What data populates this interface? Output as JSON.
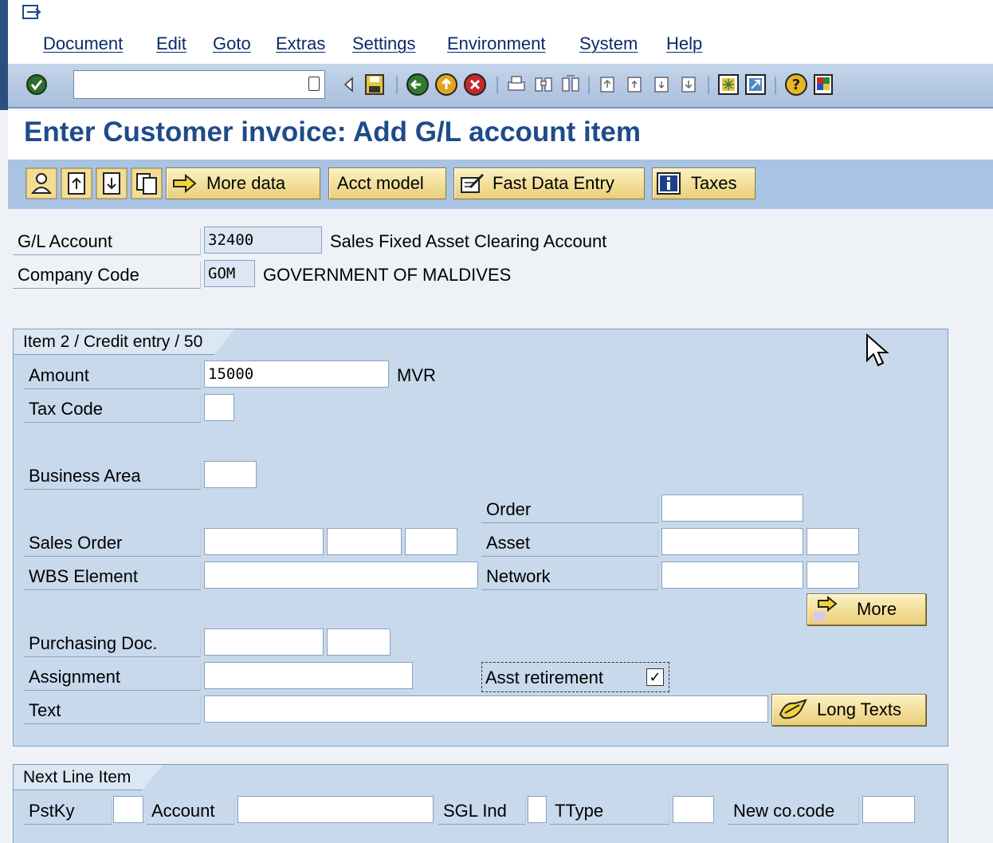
{
  "menubar": {
    "items": [
      "Document",
      "Edit",
      "Goto",
      "Extras",
      "Settings",
      "Environment",
      "System",
      "Help"
    ]
  },
  "toolbar": {
    "command_field_value": ""
  },
  "page": {
    "title": "Enter Customer invoice: Add G/L account item"
  },
  "app_toolbar": {
    "buttons": [
      "More data",
      "Acct model",
      "Fast Data Entry",
      "Taxes"
    ]
  },
  "header": {
    "gl_account": {
      "label": "G/L Account",
      "value": "32400",
      "description": "Sales Fixed Asset Clearing Account"
    },
    "company_code": {
      "label": "Company Code",
      "value": "GOM",
      "description": "GOVERNMENT OF MALDIVES"
    }
  },
  "item_group": {
    "title": "Item 2 / Credit entry / 50",
    "amount": {
      "label": "Amount",
      "value": "15000",
      "currency": "MVR"
    },
    "tax_code": {
      "label": "Tax Code",
      "value": ""
    },
    "business_area": {
      "label": "Business Area",
      "value": ""
    },
    "order": {
      "label": "Order",
      "value": ""
    },
    "sales_order": {
      "label": "Sales Order",
      "values": [
        "",
        "",
        ""
      ]
    },
    "asset": {
      "label": "Asset",
      "values": [
        "",
        ""
      ]
    },
    "wbs_element": {
      "label": "WBS Element",
      "value": ""
    },
    "network": {
      "label": "Network",
      "values": [
        "",
        ""
      ]
    },
    "more_button": "More",
    "purchasing_doc": {
      "label": "Purchasing Doc.",
      "values": [
        "",
        ""
      ]
    },
    "assignment": {
      "label": "Assignment",
      "value": ""
    },
    "asst_retirement": {
      "label": "Asst retirement",
      "checked": true,
      "check_glyph": "✓"
    },
    "text": {
      "label": "Text",
      "value": ""
    },
    "long_texts_button": "Long Texts"
  },
  "next_line": {
    "title": "Next Line Item",
    "pstky": {
      "label": "PstKy",
      "value": ""
    },
    "account": {
      "label": "Account",
      "value": ""
    },
    "sgl_ind": {
      "label": "SGL Ind",
      "value": ""
    },
    "ttype": {
      "label": "TType",
      "value": ""
    },
    "new_co_code": {
      "label": "New co.code",
      "value": ""
    }
  },
  "colors": {
    "title": "#1f4b8a",
    "group_bg": "#c8d9ec",
    "button": "#e9cf78"
  }
}
